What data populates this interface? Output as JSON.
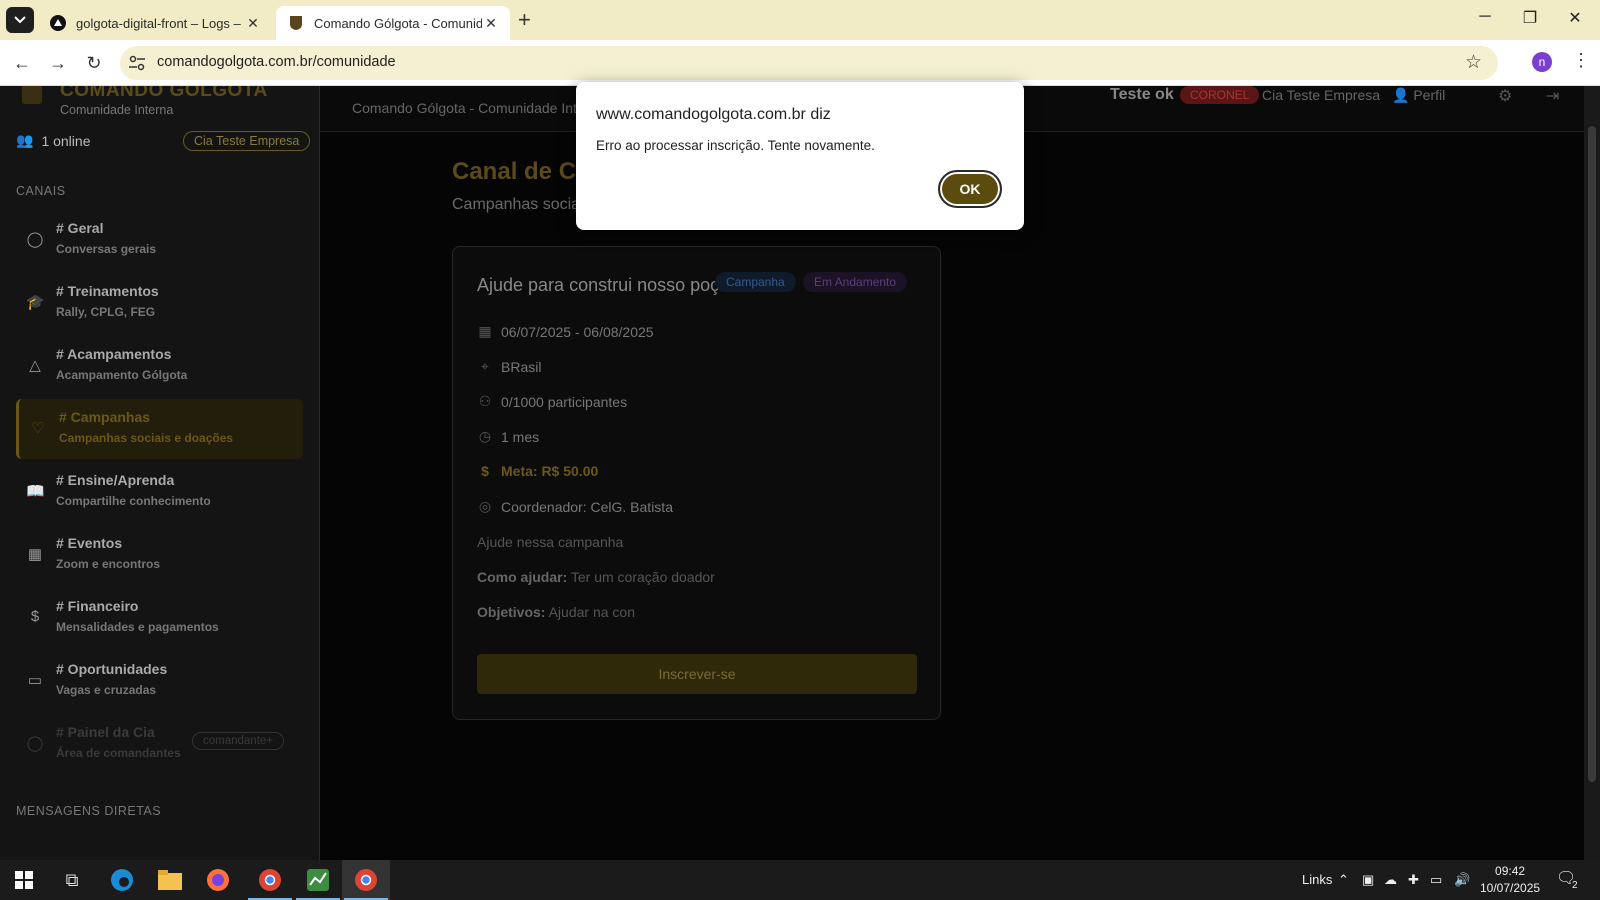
{
  "browser": {
    "tabs": [
      {
        "title": "golgota-digital-front – Logs – V",
        "active": false
      },
      {
        "title": "Comando Gólgota - Comunidade",
        "active": true
      }
    ],
    "url": "comandogolgota.com.br/comunidade",
    "profile_initial": "n"
  },
  "sidebar": {
    "brand": "COMANDO GÓLGOTA",
    "brand_sub": "Comunidade Interna",
    "online": "1 online",
    "cia_badge": "Cia Teste Empresa",
    "channels_label": "CANAIS",
    "channels": [
      {
        "name": "# Geral",
        "desc": "Conversas gerais",
        "icon": "chat-icon"
      },
      {
        "name": "# Treinamentos",
        "desc": "Rally, CPLG, FEG",
        "icon": "graduation-icon"
      },
      {
        "name": "# Acampamentos",
        "desc": "Acampamento Gólgota",
        "icon": "tent-icon"
      },
      {
        "name": "# Campanhas",
        "desc": "Campanhas sociais e doações",
        "icon": "heart-icon",
        "active": true
      },
      {
        "name": "# Ensine/Aprenda",
        "desc": "Compartilhe conhecimento",
        "icon": "book-icon"
      },
      {
        "name": "# Eventos",
        "desc": "Zoom e encontros",
        "icon": "calendar-icon"
      },
      {
        "name": "# Financeiro",
        "desc": "Mensalidades e pagamentos",
        "icon": "dollar-icon"
      },
      {
        "name": "# Oportunidades",
        "desc": "Vagas e cruzadas",
        "icon": "briefcase-icon"
      },
      {
        "name": "# Painel da Cia",
        "desc": "Área de comandantes",
        "icon": "shield-icon",
        "badge": "comandante+",
        "faded": true
      }
    ],
    "dm_label": "MENSAGENS DIRETAS"
  },
  "topbar": {
    "crumb": "Comando Gólgota - Comunidade Interna",
    "user": "Teste ok",
    "rank": "CORONEL",
    "cia": "Cia Teste Empresa",
    "perfil": "Perfil"
  },
  "main": {
    "heading": "Canal de Campanhas",
    "lead": "Campanhas sociais e doações organizadas pelas nossas comunidades.",
    "card": {
      "title": "Ajude para construi nosso poço",
      "tag_type": "Campanha",
      "tag_status": "Em Andamento",
      "dates": "06/07/2025 - 06/08/2025",
      "location": "BRasil",
      "participants": "0/1000 participantes",
      "duration": "1 mes",
      "goal": "Meta: R$ 50.00",
      "coordinator": "Coordenador: CelG. Batista",
      "description": "Ajude nessa campanha",
      "how_label": "Como ajudar:",
      "how_value": "Ter um coração doador",
      "objectives_label": "Objetivos:",
      "objectives_value": "Ajudar na con",
      "cta": "Inscrever-se"
    }
  },
  "dialog": {
    "title": "www.comandogolgota.com.br diz",
    "message": "Erro ao processar inscrição. Tente novamente.",
    "ok_label": "OK"
  },
  "taskbar": {
    "links_label": "Links",
    "time": "09:42",
    "date": "10/07/2025",
    "notification_count": "2"
  }
}
